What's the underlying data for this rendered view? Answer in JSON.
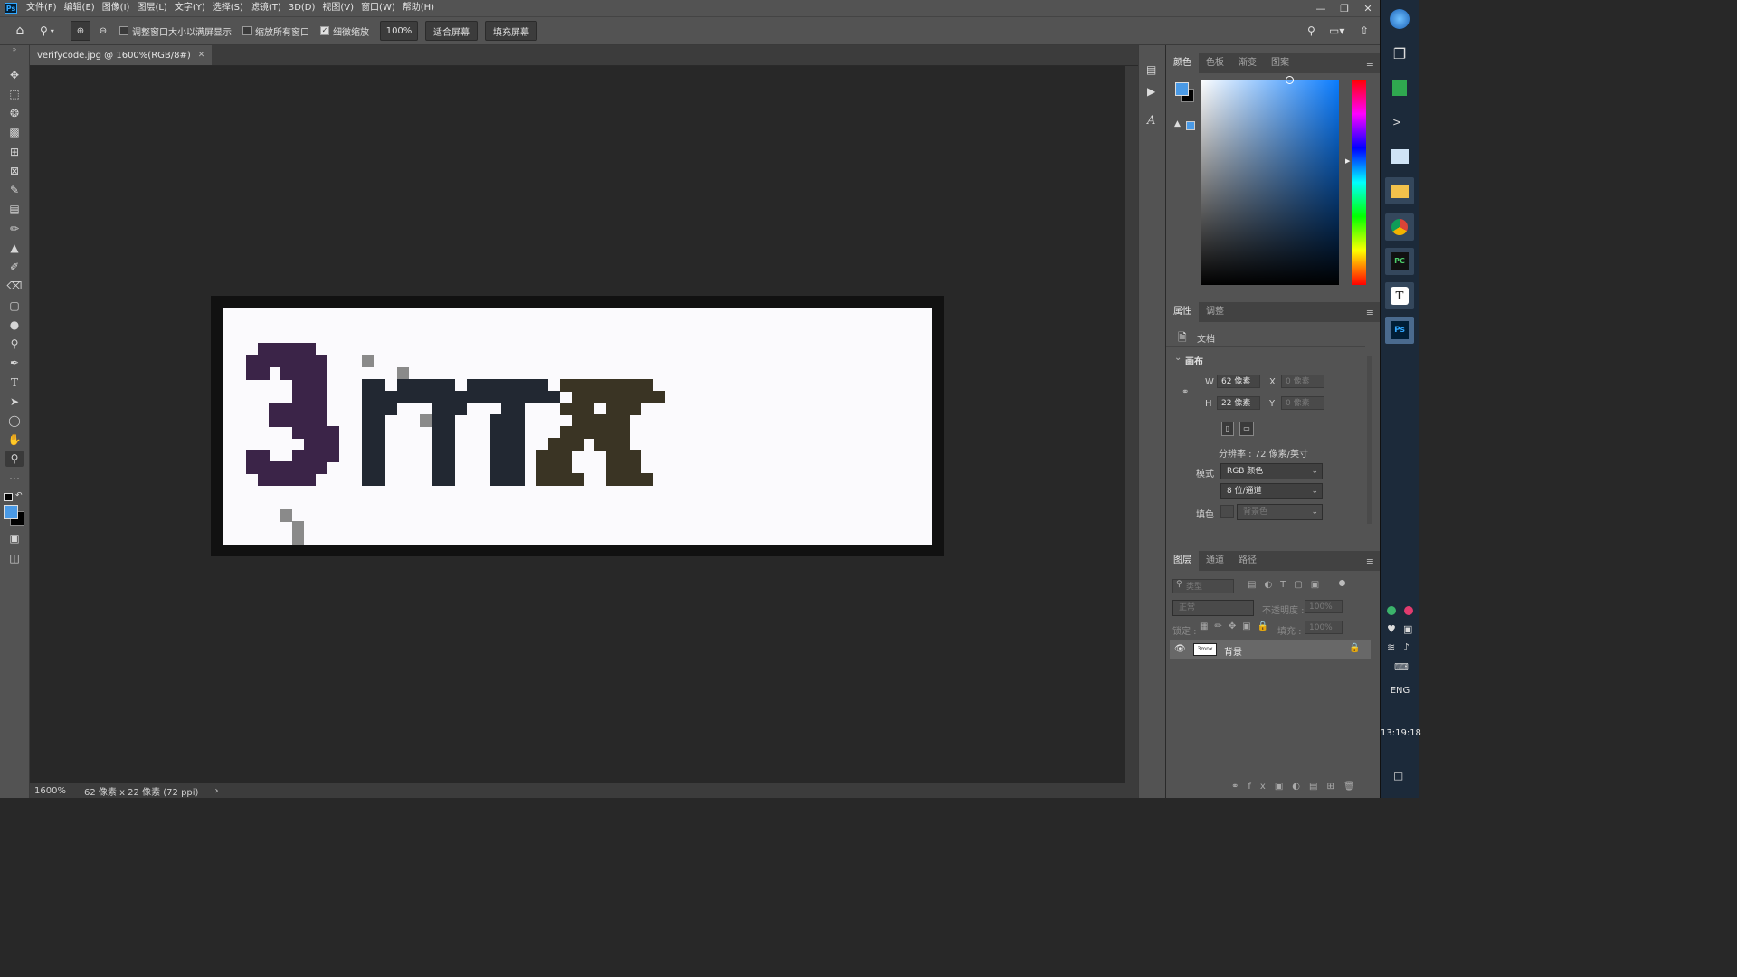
{
  "app": {
    "logo": "Ps"
  },
  "menu": [
    "文件(F)",
    "编辑(E)",
    "图像(I)",
    "图层(L)",
    "文字(Y)",
    "选择(S)",
    "滤镜(T)",
    "3D(D)",
    "视图(V)",
    "窗口(W)",
    "帮助(H)"
  ],
  "options": {
    "resize_windows_label": "调整窗口大小以满屏显示",
    "resize_windows_checked": false,
    "zoom_all_label": "缩放所有窗口",
    "zoom_all_checked": false,
    "scrubby_zoom_label": "细微缩放",
    "scrubby_zoom_checked": true,
    "zoom_value": "100%",
    "fit_screen_label": "适合屏幕",
    "fill_screen_label": "填充屏幕"
  },
  "document": {
    "tab_title": "verifycode.jpg @ 1600%(RGB/8#)",
    "image_rows": [
      "0000000000000000000000000000000000000000000000000000000000000",
      "0000000000000000000000000000000000000000000000000000000000000",
      "0000000000000000000000000000000000000000000000000000000000000",
      "000PPPPP0000000000000000000000000000000000000000000000000000",
      "00PPPPPPP000G000000000000000000000000000000000000000000000000",
      "00PP0PPPP000000G00000000000000000000000000000000000000000000",
      "000000PPP000NN0NNNNN0NNNNNNN0OOOOOOOO0000000000000000000000000",
      "000000PPP000NNNNNNNNNNNNNNNNN0OOOOOOOO000000000000000000000000",
      "0000PPPPP000NNN000NNN000NN000OOO0OOO000000000000000000000000000",
      "0000PPPPP000NN000GNN000NNN0000OOOOO00000000000000000000000000000",
      "000000PPPP00NN0000NN000NNN000OOOOOO00000000000000000000000000000",
      "0000000PPP00NN0000NN000NNN00OOO0OOO0000000000000000000000000000",
      "00PP00PPPP00NN0000NN000NNN0OOO000OOO000000000000000000000000000",
      "00PPPPPPP000NN0000NN000NNN0OOO000OOO000000000000000000000000000",
      "000PPPPP0000NN0000NN000NNN0OOOO00OOOO00000000000000000000000000",
      "0000000000000000000000000000000000000000000000000000000000000",
      "0000000000000000000000000000000000000000000000000000000000000",
      "00000G000000000000000000000000000000000000000000000000000000000",
      "000000G00000000000000000000000000000000000000000000000000000000",
      "000000G00000000000000000000000000000000000000000000000000000000"
    ],
    "palette": {
      "0": "#fbfafd",
      "P": "#3b2448",
      "N": "#222832",
      "O": "#3a3424",
      "G": "#8a8a8a",
      "B": "#141414"
    }
  },
  "status": {
    "zoom": "1600%",
    "doc_info": "62 像素 x 22 像素 (72 ppi)"
  },
  "color_panel": {
    "tabs": [
      "颜色",
      "色板",
      "渐变",
      "图案"
    ],
    "foreground": "#4a9ae6",
    "background": "#000000"
  },
  "properties_panel": {
    "tabs": [
      "属性",
      "调整"
    ],
    "doc_label": "文档",
    "canvas_label": "画布",
    "w_label": "W",
    "w_value": "62 像素",
    "h_label": "H",
    "h_value": "22 像素",
    "x_label": "X",
    "x_value": "0 像素",
    "y_label": "Y",
    "y_value": "0 像素",
    "resolution": "分辨率 : 72 像素/英寸",
    "mode_label": "模式",
    "mode_value": "RGB 颜色",
    "depth_value": "8 位/通道",
    "fill_label": "填色",
    "fill_value": "背景色"
  },
  "layers_panel": {
    "tabs": [
      "图层",
      "通道",
      "路径"
    ],
    "filter_placeholder": "类型",
    "blend_mode": "正常",
    "opacity_label": "不透明度 :",
    "opacity_value": "100%",
    "lock_label": "锁定 :",
    "fill_label": "填充 :",
    "fill_value": "100%",
    "layers": [
      {
        "name": "背景",
        "thumb_text": "3mnx"
      }
    ]
  },
  "taskbar": {
    "lang": "ENG",
    "clock": "13:19:18"
  }
}
